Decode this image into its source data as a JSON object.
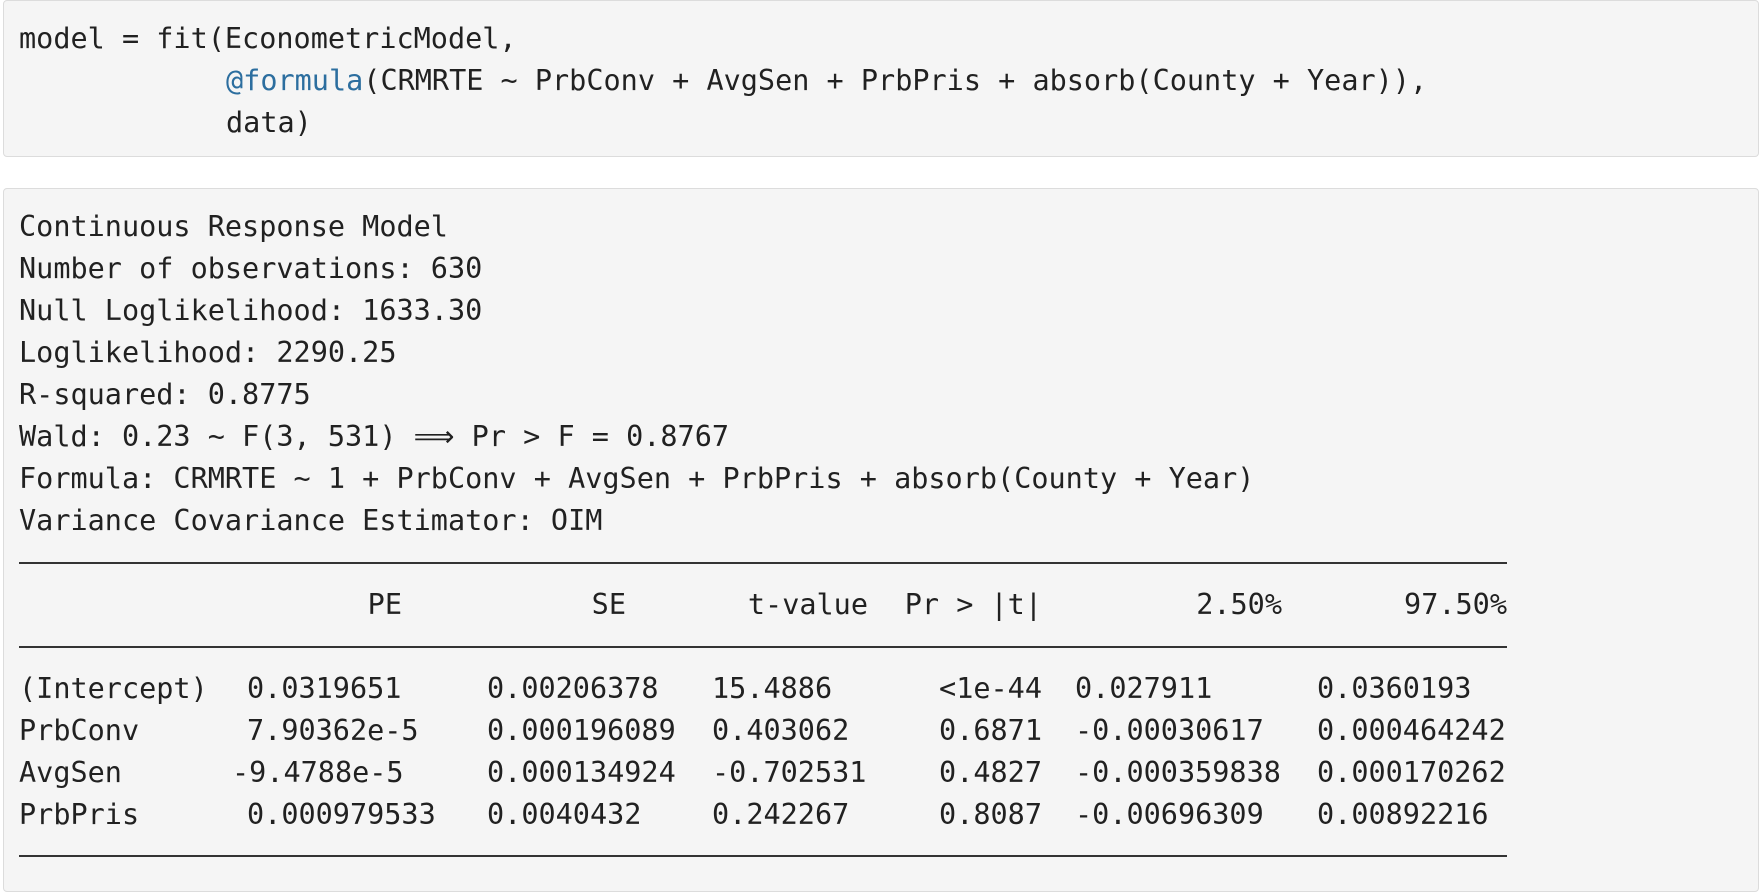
{
  "code": {
    "line1": "model = fit(EconometricModel,",
    "line2_macro": "@formula",
    "line2_rest": "(CRMRTE ~ PrbConv + AvgSen + PrbPris + absorb(County + Year)),",
    "line3": "data)"
  },
  "output": {
    "header_lines": [
      "Continuous Response Model",
      "Number of observations: 630",
      "Null Loglikelihood: 1633.30",
      "Loglikelihood: 2290.25",
      "R-squared: 0.8775",
      "Wald: 0.23 ~ F(3, 531) ⟹ Pr > F = 0.8767",
      "Formula: CRMRTE ~ 1 + PrbConv + AvgSen + PrbPris + absorb(County + Year)",
      "Variance Covariance Estimator: OIM"
    ],
    "table": {
      "columns": [
        "PE",
        "SE",
        "t-value",
        "Pr > |t|",
        "2.50%",
        "97.50%"
      ],
      "rows": [
        {
          "name": "(Intercept)",
          "cells": [
            "0.0319651",
            "0.00206378",
            "15.4886",
            "<1e-44",
            "0.027911",
            "0.0360193"
          ]
        },
        {
          "name": "PrbConv",
          "cells": [
            "7.90362e-5",
            "0.000196089",
            "0.403062",
            "0.6871",
            "-0.00030617",
            "0.000464242"
          ]
        },
        {
          "name": "AvgSen",
          "cells": [
            "-9.4788e-5",
            "0.000134924",
            "-0.702531",
            "0.4827",
            "-0.000359838",
            "0.000170262"
          ]
        },
        {
          "name": "PrbPris",
          "cells": [
            "0.000979533",
            "0.0040432",
            "0.242267",
            "0.8087",
            "-0.00696309",
            "0.00892216"
          ]
        }
      ]
    }
  }
}
